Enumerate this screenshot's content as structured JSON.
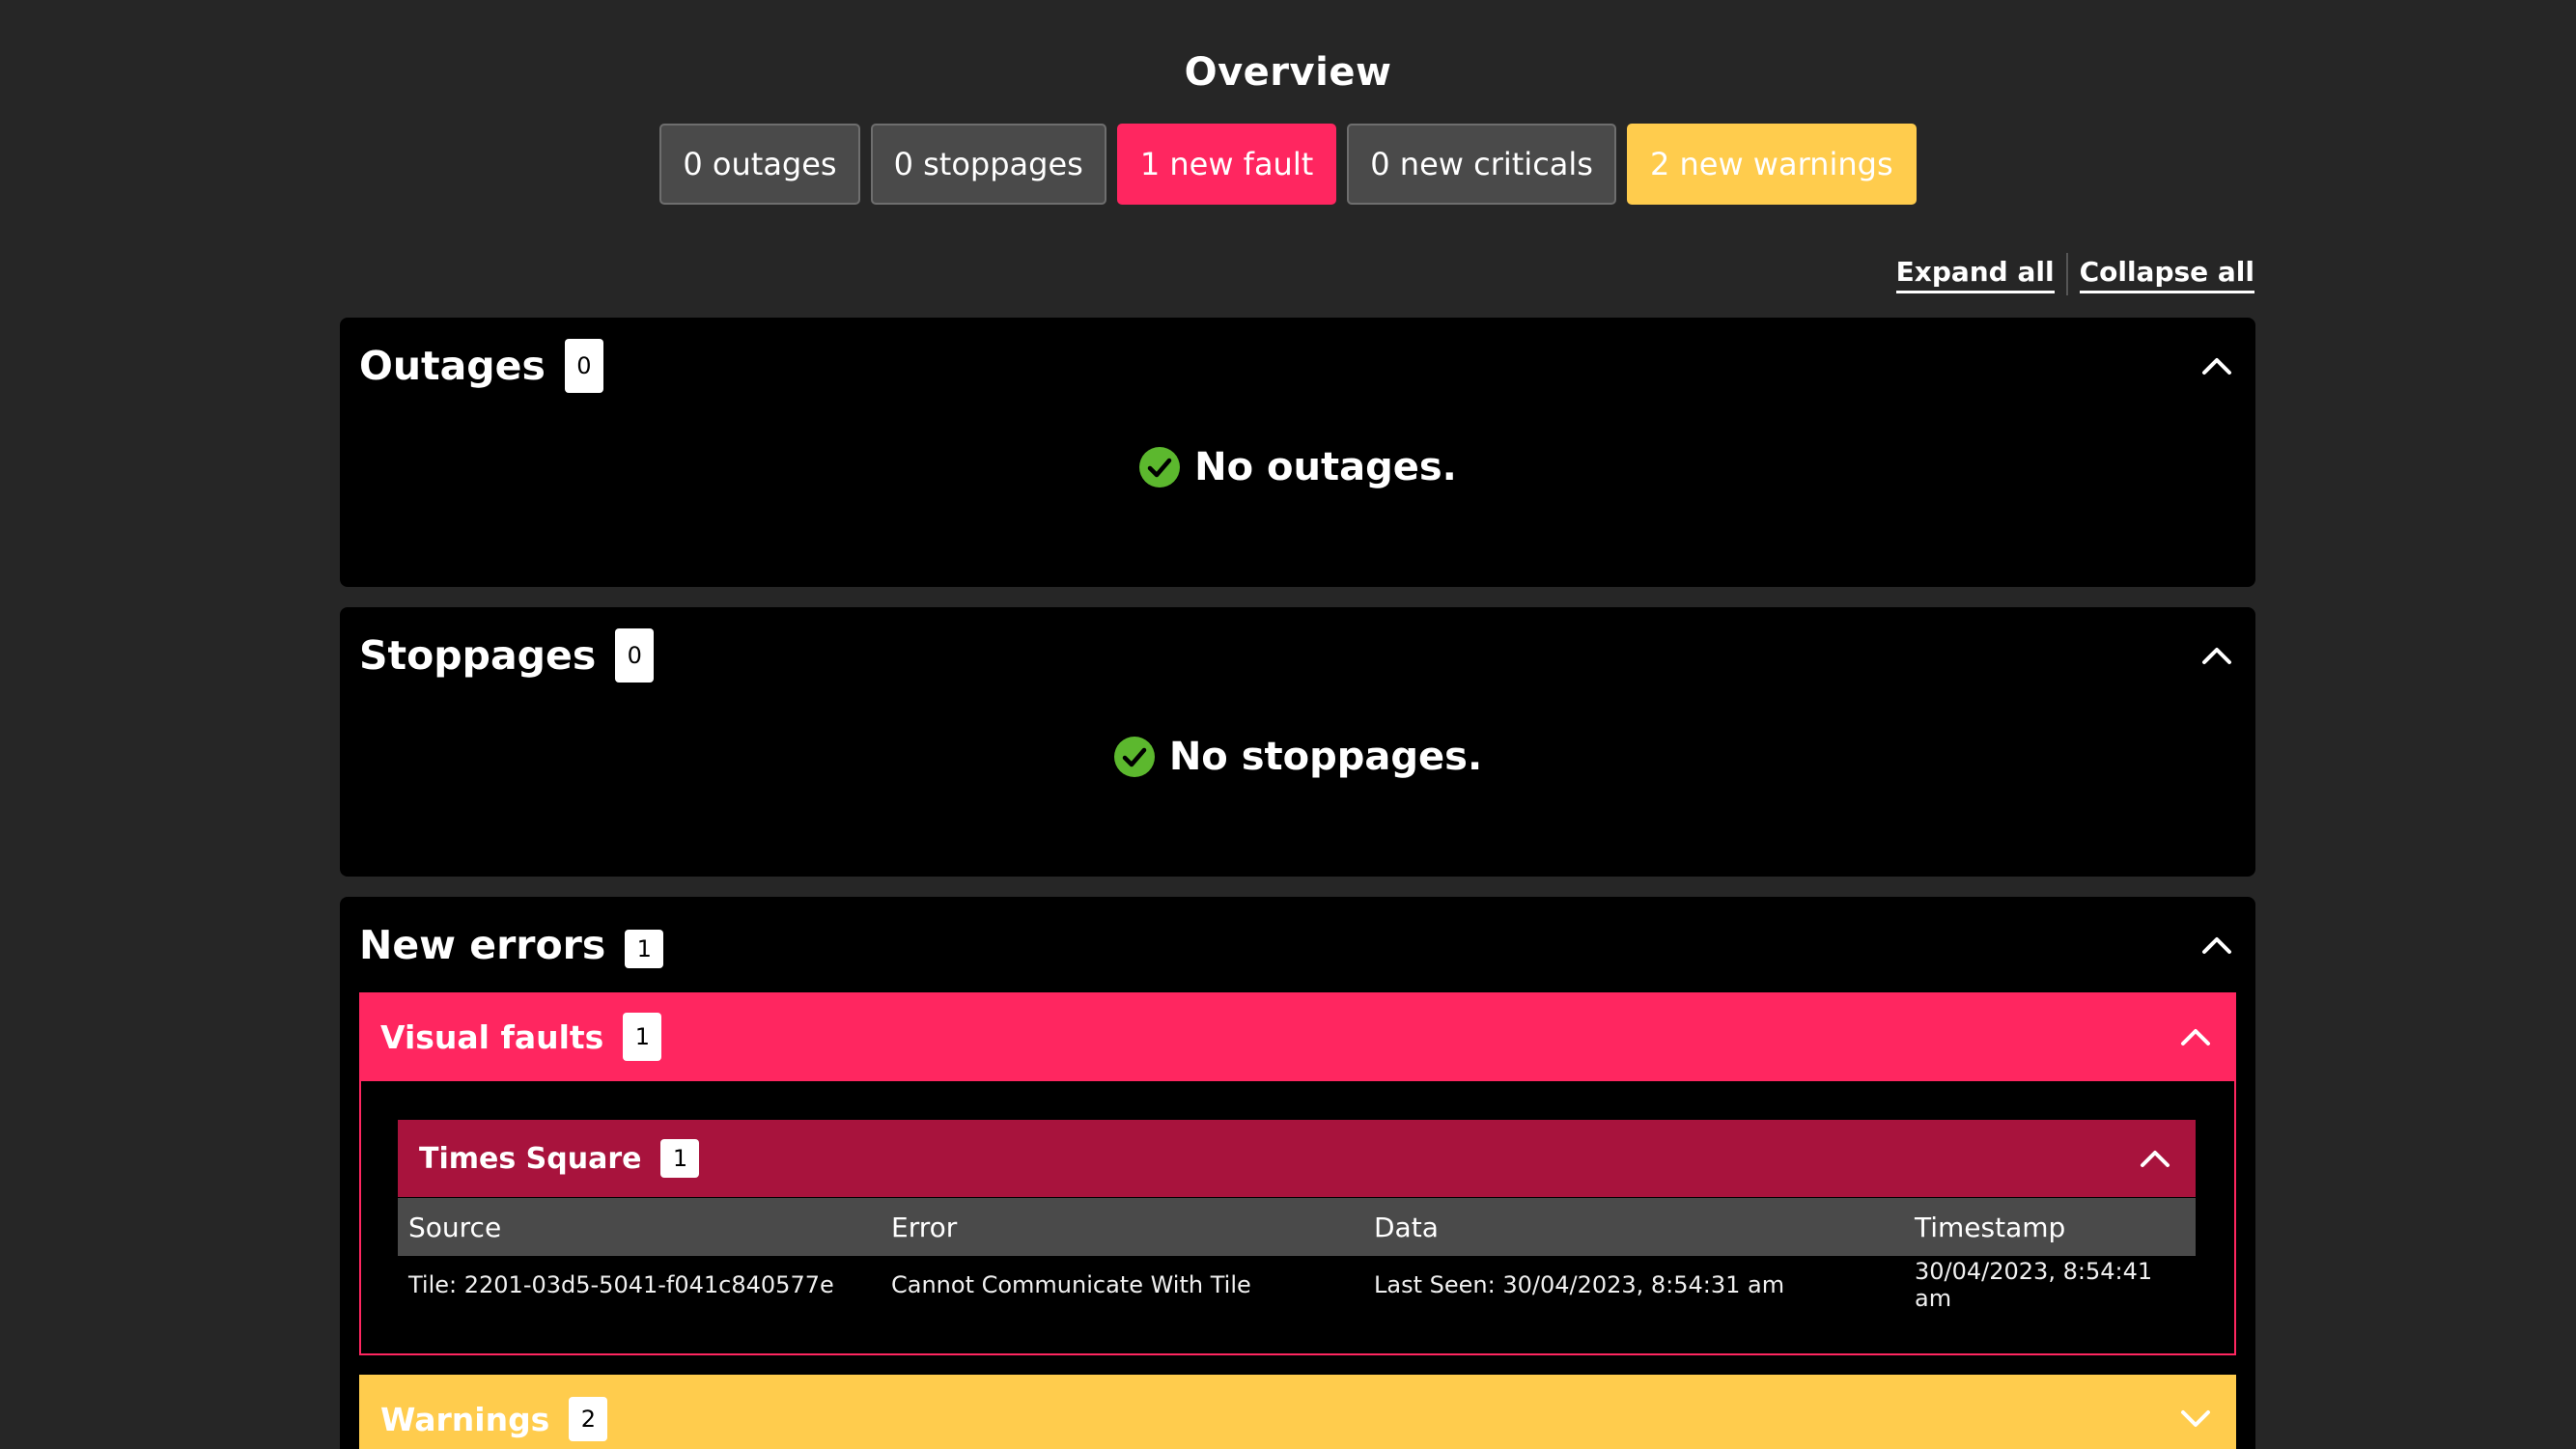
{
  "page": {
    "title": "Overview"
  },
  "summary": {
    "outages": "0 outages",
    "stoppages": "0 stoppages",
    "faults": "1 new fault",
    "criticals": "0 new criticals",
    "warnings": "2 new warnings"
  },
  "controls": {
    "expand_all": "Expand all",
    "collapse_all": "Collapse all"
  },
  "outages": {
    "title": "Outages",
    "count": "0",
    "empty": "No outages."
  },
  "stoppages": {
    "title": "Stoppages",
    "count": "0",
    "empty": "No stoppages."
  },
  "new_errors": {
    "title": "New errors",
    "count": "1",
    "visual_faults": {
      "title": "Visual faults",
      "count": "1",
      "site": {
        "title": "Times Square",
        "count": "1",
        "columns": [
          "Source",
          "Error",
          "Data",
          "Timestamp"
        ],
        "rows": [
          {
            "source": "Tile: 2201-03d5-5041-f041c840577e",
            "error": "Cannot Communicate With Tile",
            "data": "Last Seen: 30/04/2023, 8:54:31 am",
            "timestamp": "30/04/2023, 8:54:41 am"
          }
        ]
      }
    },
    "warnings": {
      "title": "Warnings",
      "count": "2"
    }
  },
  "colors": {
    "background": "#262626",
    "panel": "#000000",
    "fault": "#ff2660",
    "fault_dark": "#a8133d",
    "warning": "#ffcc4d",
    "ok": "#5cb82e"
  },
  "icons": {
    "collapse": "chevron-up-icon",
    "expand": "chevron-down-icon",
    "ok": "check-circle-icon"
  }
}
